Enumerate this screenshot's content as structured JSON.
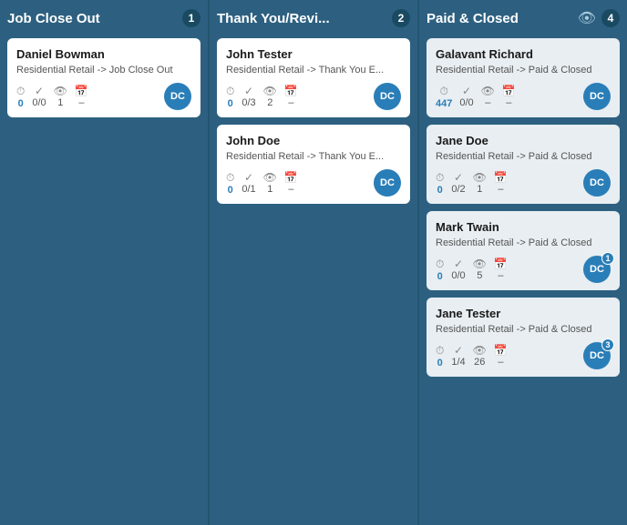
{
  "columns": [
    {
      "id": "job-close-out",
      "title": "Job Close Out",
      "badge": "1",
      "hasEye": false,
      "cards": [
        {
          "name": "Daniel Bowman",
          "subtitle": "Residential Retail -> Job Close Out",
          "stats": [
            {
              "icon": "🕐",
              "value": "0",
              "blue": true
            },
            {
              "icon": "✓",
              "value": "0/0"
            },
            {
              "icon": "👁",
              "value": "1"
            },
            {
              "icon": "📅",
              "value": "–"
            }
          ],
          "avatar": "DC",
          "avatarBadge": null
        }
      ]
    },
    {
      "id": "thank-you-review",
      "title": "Thank You/Revi...",
      "badge": "2",
      "hasEye": false,
      "cards": [
        {
          "name": "John Tester",
          "subtitle": "Residential Retail -> Thank You E...",
          "stats": [
            {
              "icon": "🕐",
              "value": "0",
              "blue": true
            },
            {
              "icon": "✓",
              "value": "0/3"
            },
            {
              "icon": "👁",
              "value": "2"
            },
            {
              "icon": "📅",
              "value": "–"
            }
          ],
          "avatar": "DC",
          "avatarBadge": null
        },
        {
          "name": "John Doe",
          "subtitle": "Residential Retail -> Thank You E...",
          "stats": [
            {
              "icon": "🕐",
              "value": "0",
              "blue": true
            },
            {
              "icon": "✓",
              "value": "0/1"
            },
            {
              "icon": "👁",
              "value": "1"
            },
            {
              "icon": "📅",
              "value": "–"
            }
          ],
          "avatar": "DC",
          "avatarBadge": null
        }
      ]
    },
    {
      "id": "paid-closed",
      "title": "Paid & Closed",
      "badge": "4",
      "hasEye": true,
      "cards": [
        {
          "name": "Galavant Richard",
          "subtitle": "Residential Retail -> Paid & Closed",
          "stats": [
            {
              "icon": "🕐",
              "value": "447",
              "blue": true
            },
            {
              "icon": "✓",
              "value": "0/0"
            },
            {
              "icon": "👁",
              "value": "–"
            },
            {
              "icon": "📅",
              "value": "–"
            }
          ],
          "avatar": "DC",
          "avatarBadge": null
        },
        {
          "name": "Jane Doe",
          "subtitle": "Residential Retail -> Paid & Closed",
          "stats": [
            {
              "icon": "🕐",
              "value": "0",
              "blue": true
            },
            {
              "icon": "✓",
              "value": "0/2"
            },
            {
              "icon": "👁",
              "value": "1"
            },
            {
              "icon": "📅",
              "value": "–"
            }
          ],
          "avatar": "DC",
          "avatarBadge": null
        },
        {
          "name": "Mark Twain",
          "subtitle": "Residential Retail -> Paid & Closed",
          "stats": [
            {
              "icon": "🕐",
              "value": "0",
              "blue": true
            },
            {
              "icon": "✓",
              "value": "0/0"
            },
            {
              "icon": "👁",
              "value": "5"
            },
            {
              "icon": "📅",
              "value": "–"
            }
          ],
          "avatar": "DC",
          "avatarBadge": "1"
        },
        {
          "name": "Jane Tester",
          "subtitle": "Residential Retail -> Paid & Closed",
          "stats": [
            {
              "icon": "🕐",
              "value": "0",
              "blue": true
            },
            {
              "icon": "✓",
              "value": "1/4"
            },
            {
              "icon": "👁",
              "value": "26"
            },
            {
              "icon": "📅",
              "value": "–"
            }
          ],
          "avatar": "DC",
          "avatarBadge": "3"
        }
      ]
    }
  ]
}
